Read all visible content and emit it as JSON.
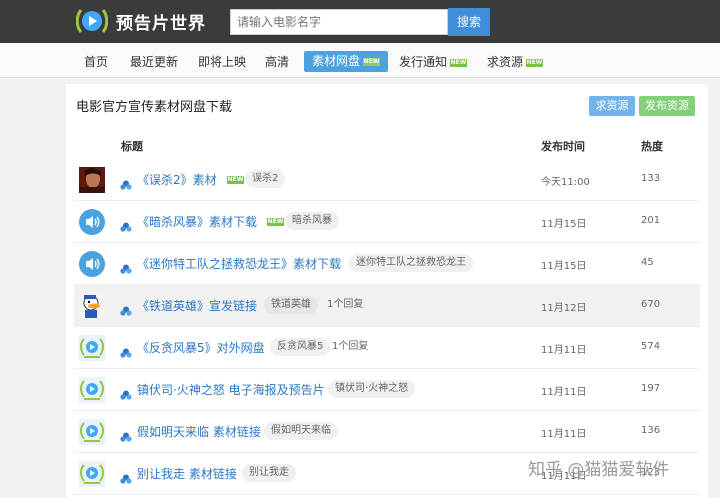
{
  "header": {
    "logo_text": "预告片世界",
    "search_placeholder": "请输入电影名字",
    "search_button": "搜索"
  },
  "nav": {
    "items": [
      {
        "label": "首页"
      },
      {
        "label": "最近更新"
      },
      {
        "label": "即将上映"
      },
      {
        "label": "高清"
      },
      {
        "label": "素材网盘",
        "badge": "NEW",
        "active": true
      },
      {
        "label": "发行通知",
        "badge": "NEW"
      },
      {
        "label": "求资源",
        "badge": "NEW"
      }
    ]
  },
  "main": {
    "title": "电影官方宣传素材网盘下载",
    "ask_button": "求资源",
    "post_button": "发布资源",
    "columns": {
      "title": "标题",
      "date": "发布时间",
      "heat": "热度"
    },
    "rows": [
      {
        "title": "《误杀2》素材",
        "badge": "NEW",
        "tag": "误杀2",
        "date": "今天11:00",
        "heat": "133",
        "thumb": "portrait"
      },
      {
        "title": "《暗杀风暴》素材下载",
        "badge": "NEW",
        "tag": "暗杀风暴",
        "date": "11月15日",
        "heat": "201",
        "thumb": "speaker"
      },
      {
        "title": "《迷你特工队之拯救恐龙王》素材下载",
        "tag": "迷你特工队之拯救恐龙王",
        "date": "11月15日",
        "heat": "45",
        "thumb": "speaker"
      },
      {
        "title": "《铁道英雄》宣发链接",
        "tag": "铁道英雄",
        "replies": "1个回复",
        "date": "11月12日",
        "heat": "670",
        "thumb": "duck"
      },
      {
        "title": "《反贪风暴5》对外网盘",
        "tag": "反贪风暴5",
        "replies": "1个回复",
        "date": "11月11日",
        "heat": "574",
        "thumb": "logo"
      },
      {
        "title": "镇伏司·火神之怒 电子海报及预告片",
        "tag": "镇伏司·火神之怒",
        "date": "11月11日",
        "heat": "197",
        "thumb": "logo"
      },
      {
        "title": "假如明天来临 素材链接",
        "tag": "假如明天来临",
        "date": "11月11日",
        "heat": "136",
        "thumb": "logo"
      },
      {
        "title": "别让我走 素材链接",
        "tag": "别让我走",
        "date": "11月11日",
        "heat": "123",
        "thumb": "logo"
      }
    ]
  },
  "watermark": "知乎 @猫猫爱软件",
  "colors": {
    "topbar": "#3b3b3b",
    "accent": "#4aa3df",
    "link": "#2b78c6",
    "new_badge": "#7cc242",
    "post_button": "#84d07a"
  }
}
